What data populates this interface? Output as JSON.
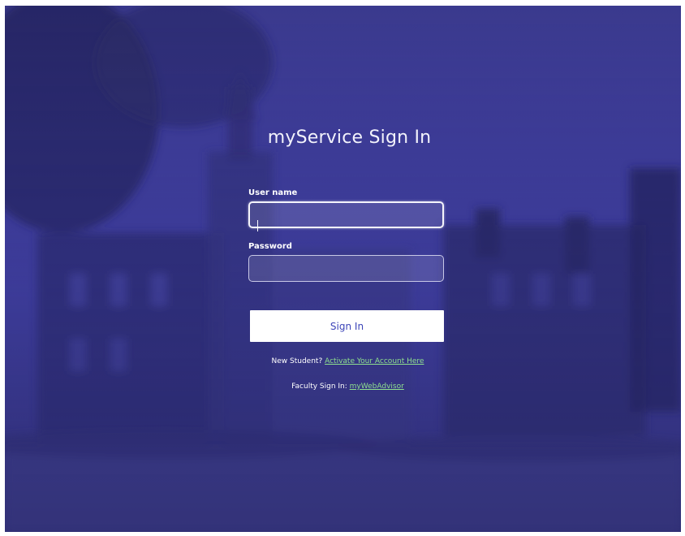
{
  "page": {
    "title": "myService Sign In"
  },
  "form": {
    "username_label": "User name",
    "username_value": "",
    "password_label": "Password",
    "password_value": "",
    "signin_label": "Sign In"
  },
  "links": {
    "new_student_prefix": "New Student? ",
    "activate_link": "Activate Your Account Here",
    "faculty_prefix": "Faculty Sign In: ",
    "faculty_link": "myWebAdvisor"
  },
  "colors": {
    "overlay": "#403fa0",
    "button_text": "#3c44b8",
    "link": "#8fe08f"
  }
}
